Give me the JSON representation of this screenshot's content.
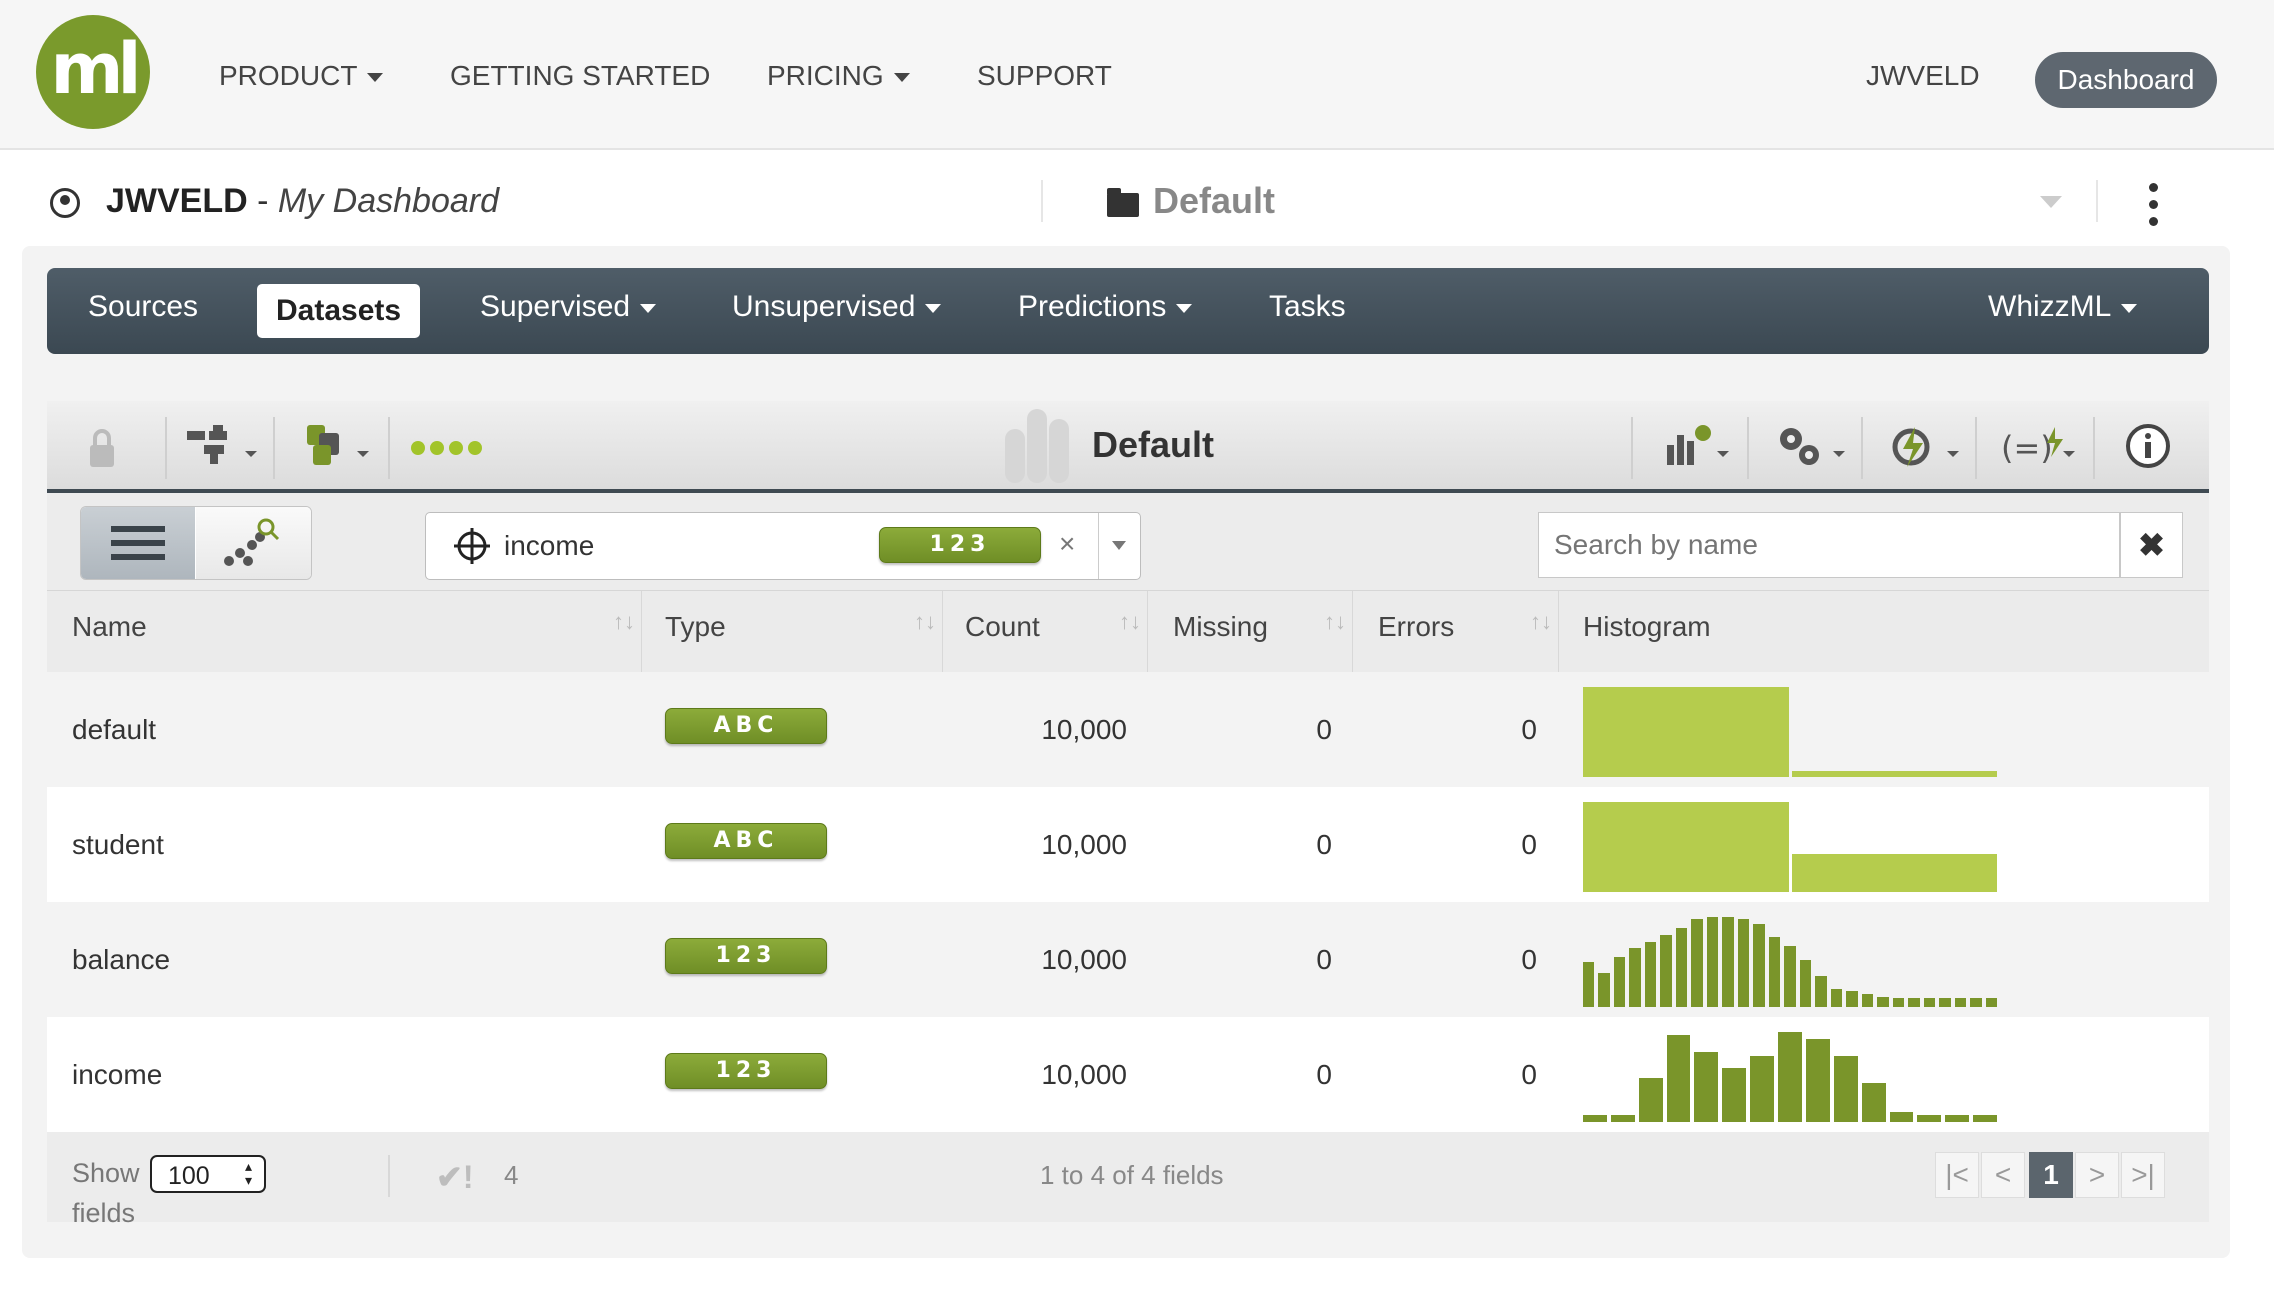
{
  "logo": {
    "text": "ml"
  },
  "nav": {
    "items": [
      {
        "label": "PRODUCT",
        "dropdown": true
      },
      {
        "label": "GETTING STARTED",
        "dropdown": false
      },
      {
        "label": "PRICING",
        "dropdown": true
      },
      {
        "label": "SUPPORT",
        "dropdown": false
      }
    ],
    "username": "JWVELD",
    "dashboard_button": "Dashboard"
  },
  "header": {
    "user": "JWVELD",
    "separator": " - ",
    "subtitle": "My Dashboard",
    "project": "Default"
  },
  "main_tabs": [
    {
      "label": "Sources",
      "active": false
    },
    {
      "label": "Datasets",
      "active": true
    },
    {
      "label": "Supervised",
      "active": false,
      "dropdown": true
    },
    {
      "label": "Unsupervised",
      "active": false,
      "dropdown": true
    },
    {
      "label": "Predictions",
      "active": false,
      "dropdown": true
    },
    {
      "label": "Tasks",
      "active": false
    }
  ],
  "whizzml_tab": "WhizzML",
  "toolbar": {
    "dataset_name": "Default",
    "status_dots": 4,
    "dot_color": "#a2c42a"
  },
  "objective": {
    "field": "income",
    "type_badge": "123",
    "clear": "×"
  },
  "search": {
    "placeholder": "Search by name",
    "clear": "✖"
  },
  "table": {
    "headers": [
      "Name",
      "Type",
      "Count",
      "Missing",
      "Errors",
      "Histogram"
    ],
    "rows": [
      {
        "name": "default",
        "type": "ABC",
        "count": "10,000",
        "missing": "0",
        "errors": "0",
        "histogram": {
          "kind": "categorical",
          "color": "#b5cc4d",
          "bins": [
            10000,
            333
          ]
        }
      },
      {
        "name": "student",
        "type": "ABC",
        "count": "10,000",
        "missing": "0",
        "errors": "0",
        "histogram": {
          "kind": "categorical",
          "color": "#b5cc4d",
          "bins": [
            7056,
            2944
          ]
        }
      },
      {
        "name": "balance",
        "type": "123",
        "count": "10,000",
        "missing": "0",
        "errors": "0",
        "histogram": {
          "kind": "numeric",
          "color": "#7a952a",
          "bins": [
            50,
            38,
            55,
            65,
            72,
            80,
            88,
            98,
            100,
            100,
            98,
            92,
            78,
            68,
            52,
            35,
            20,
            18,
            14,
            11,
            10,
            10,
            10,
            10,
            10,
            10,
            10
          ]
        }
      },
      {
        "name": "income",
        "type": "123",
        "count": "10,000",
        "missing": "0",
        "errors": "0",
        "histogram": {
          "kind": "numeric",
          "color": "#7a952a",
          "bins": [
            8,
            8,
            50,
            100,
            80,
            62,
            75,
            103,
            95,
            75,
            45,
            12,
            8,
            8,
            8
          ]
        }
      }
    ]
  },
  "footer": {
    "show_label": "Show",
    "show_value": "100",
    "fields_label": "fields",
    "check_marks": "✔!",
    "error_count": "4",
    "range_text": "1 to 4 of 4 fields",
    "pager": {
      "first": "|<",
      "prev": "<",
      "current": "1",
      "next": ">",
      "last": ">|"
    }
  }
}
